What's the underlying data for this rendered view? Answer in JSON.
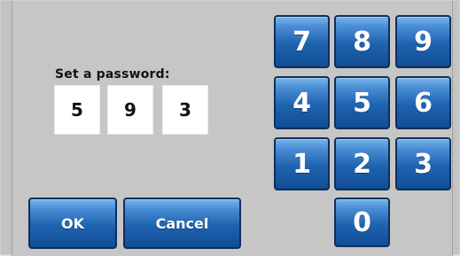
{
  "password_prompt": {
    "label": "Set a password:",
    "digits": [
      "5",
      "9",
      "3"
    ]
  },
  "keypad": {
    "keys": [
      "7",
      "8",
      "9",
      "4",
      "5",
      "6",
      "1",
      "2",
      "3",
      "0"
    ]
  },
  "actions": {
    "ok_label": "OK",
    "cancel_label": "Cancel"
  },
  "theme": {
    "button_blue_top": "#79b4ea",
    "button_blue_bottom": "#124d95",
    "button_border": "#0f2f5b",
    "panel_background": "#c6c6c6"
  }
}
